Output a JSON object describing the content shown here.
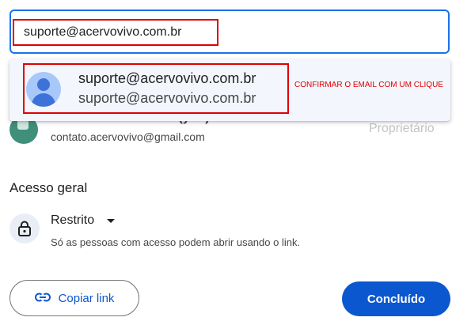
{
  "search": {
    "value": "suporte@acervovivo.com.br"
  },
  "suggestion": {
    "name": "suporte@acervovivo.com.br",
    "email": "suporte@acervovivo.com.br"
  },
  "annotation": "CONFIRMAR O EMAIL COM UM CLIQUE",
  "owner": {
    "name": "Acervo Vivo Contato (you)",
    "email": "contato.acervovivo@gmail.com",
    "role": "Proprietário"
  },
  "general_access": {
    "title": "Acesso geral",
    "selected": "Restrito",
    "description": "Só as pessoas com acesso podem abrir usando o link."
  },
  "buttons": {
    "copy_link": "Copiar link",
    "done": "Concluído"
  },
  "colors": {
    "accent": "#0b57d0",
    "focus_border": "#1a73e8",
    "annotation_red": "#e00000"
  },
  "icons": {
    "link": "link-icon",
    "lock": "lock-icon",
    "avatar": "person-avatar-icon",
    "dropdown": "caret-down-icon"
  }
}
